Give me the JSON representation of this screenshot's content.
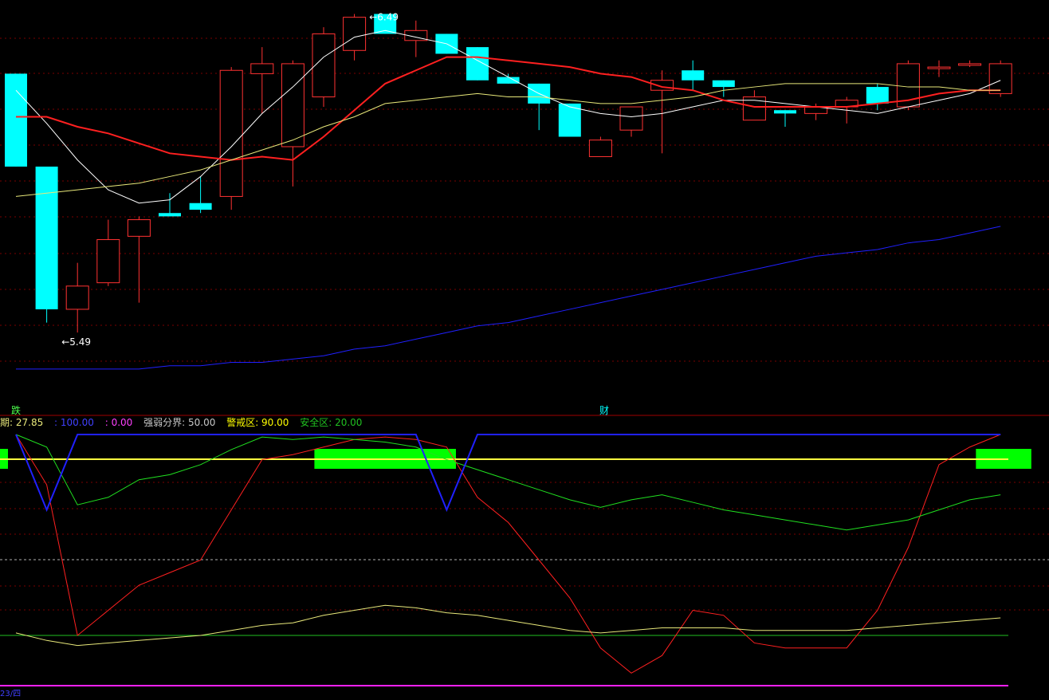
{
  "legend": {
    "period": "期: 27.85",
    "v1": ": 100.00",
    "v2": ": 0.00",
    "boundary": "强弱分界: 50.00",
    "warning": "警戒区: 90.00",
    "safe": "安全区: 20.00"
  },
  "tags": {
    "t1": "跌",
    "t2": "财"
  },
  "bottom_text": "23/四",
  "colors": {
    "up": "#ff3232",
    "down": "#00ffff",
    "ma_white": "#ffffff",
    "ma_red": "#ff2020",
    "ma_yellow": "#e8e87a",
    "ma_blue": "#2020ff",
    "grid": "#7a0000"
  },
  "chart_data": [
    {
      "type": "candlestick",
      "annotations": [
        {
          "text": "6.49",
          "candle": 12
        },
        {
          "text": "5.49",
          "candle": 2
        }
      ],
      "candles": [
        {
          "o": 6.31,
          "c": 6.03,
          "h": 6.31,
          "l": 6.03
        },
        {
          "o": 6.03,
          "c": 5.6,
          "h": 6.03,
          "l": 5.56
        },
        {
          "o": 5.6,
          "c": 5.67,
          "h": 5.74,
          "l": 5.53
        },
        {
          "o": 5.68,
          "c": 5.81,
          "h": 5.87,
          "l": 5.67
        },
        {
          "o": 5.82,
          "c": 5.87,
          "h": 5.88,
          "l": 5.62
        },
        {
          "o": 5.89,
          "c": 5.88,
          "h": 5.95,
          "l": 5.88
        },
        {
          "o": 5.92,
          "c": 5.9,
          "h": 6.0,
          "l": 5.89
        },
        {
          "o": 5.94,
          "c": 6.32,
          "h": 6.33,
          "l": 5.9
        },
        {
          "o": 6.31,
          "c": 6.34,
          "h": 6.39,
          "l": 6.19
        },
        {
          "o": 6.09,
          "c": 6.34,
          "h": 6.35,
          "l": 5.97
        },
        {
          "o": 6.24,
          "c": 6.43,
          "h": 6.45,
          "l": 6.21
        },
        {
          "o": 6.38,
          "c": 6.48,
          "h": 6.49,
          "l": 6.35
        },
        {
          "o": 6.49,
          "c": 6.43,
          "h": 6.49,
          "l": 6.43
        },
        {
          "o": 6.41,
          "c": 6.44,
          "h": 6.47,
          "l": 6.36
        },
        {
          "o": 6.43,
          "c": 6.37,
          "h": 6.43,
          "l": 6.37
        },
        {
          "o": 6.39,
          "c": 6.29,
          "h": 6.39,
          "l": 6.29
        },
        {
          "o": 6.3,
          "c": 6.28,
          "h": 6.31,
          "l": 6.28
        },
        {
          "o": 6.28,
          "c": 6.22,
          "h": 6.28,
          "l": 6.14
        },
        {
          "o": 6.22,
          "c": 6.12,
          "h": 6.22,
          "l": 6.12
        },
        {
          "o": 6.06,
          "c": 6.11,
          "h": 6.12,
          "l": 6.06
        },
        {
          "o": 6.14,
          "c": 6.21,
          "h": 6.21,
          "l": 6.12
        },
        {
          "o": 6.26,
          "c": 6.29,
          "h": 6.32,
          "l": 6.07
        },
        {
          "o": 6.32,
          "c": 6.29,
          "h": 6.35,
          "l": 6.26
        },
        {
          "o": 6.29,
          "c": 6.27,
          "h": 6.29,
          "l": 6.24
        },
        {
          "o": 6.17,
          "c": 6.24,
          "h": 6.26,
          "l": 6.17
        },
        {
          "o": 6.2,
          "c": 6.19,
          "h": 6.2,
          "l": 6.15
        },
        {
          "o": 6.19,
          "c": 6.21,
          "h": 6.22,
          "l": 6.17
        },
        {
          "o": 6.21,
          "c": 6.23,
          "h": 6.24,
          "l": 6.16
        },
        {
          "o": 6.27,
          "c": 6.22,
          "h": 6.28,
          "l": 6.2
        },
        {
          "o": 6.21,
          "c": 6.34,
          "h": 6.35,
          "l": 6.2
        },
        {
          "o": 6.33,
          "c": 6.33,
          "h": 6.35,
          "l": 6.3
        },
        {
          "o": 6.34,
          "c": 6.34,
          "h": 6.35,
          "l": 6.33
        },
        {
          "o": 6.25,
          "c": 6.34,
          "h": 6.35,
          "l": 6.24
        }
      ],
      "ma": [
        {
          "name": "white",
          "values": [
            6.26,
            6.16,
            6.05,
            5.96,
            5.92,
            5.93,
            6.0,
            6.09,
            6.19,
            6.27,
            6.36,
            6.42,
            6.44,
            6.42,
            6.4,
            6.35,
            6.3,
            6.25,
            6.21,
            6.19,
            6.18,
            6.19,
            6.21,
            6.23,
            6.23,
            6.22,
            6.21,
            6.2,
            6.19,
            6.21,
            6.23,
            6.25,
            6.29
          ]
        },
        {
          "name": "red",
          "values": [
            6.18,
            6.18,
            6.15,
            6.13,
            6.1,
            6.07,
            6.06,
            6.05,
            6.06,
            6.05,
            6.12,
            6.2,
            6.28,
            6.32,
            6.36,
            6.36,
            6.35,
            6.34,
            6.33,
            6.31,
            6.3,
            6.27,
            6.26,
            6.23,
            6.21,
            6.21,
            6.21,
            6.21,
            6.22,
            6.23,
            6.25,
            6.26,
            6.26
          ]
        },
        {
          "name": "yellow",
          "values": [
            5.94,
            5.95,
            5.96,
            5.97,
            5.98,
            6.0,
            6.02,
            6.05,
            6.08,
            6.11,
            6.15,
            6.18,
            6.22,
            6.23,
            6.24,
            6.25,
            6.24,
            6.24,
            6.23,
            6.22,
            6.22,
            6.23,
            6.24,
            6.26,
            6.27,
            6.28,
            6.28,
            6.28,
            6.28,
            6.27,
            6.27,
            6.26,
            6.26
          ]
        },
        {
          "name": "blue",
          "values": [
            5.42,
            5.42,
            5.42,
            5.42,
            5.42,
            5.43,
            5.43,
            5.44,
            5.44,
            5.45,
            5.46,
            5.48,
            5.49,
            5.51,
            5.53,
            5.55,
            5.56,
            5.58,
            5.6,
            5.62,
            5.64,
            5.66,
            5.68,
            5.7,
            5.72,
            5.74,
            5.76,
            5.77,
            5.78,
            5.8,
            5.81,
            5.83,
            5.85
          ]
        }
      ],
      "ylim": [
        5.35,
        6.52
      ]
    },
    {
      "type": "line",
      "ylim": [
        0,
        100
      ],
      "levels": [
        {
          "name": "强弱分界",
          "value": 50
        },
        {
          "name": "警戒区",
          "value": 90
        },
        {
          "name": "安全区",
          "value": 20
        }
      ],
      "series": [
        {
          "color": "red",
          "values": [
            100,
            80,
            20,
            30,
            40,
            45,
            50,
            70,
            90,
            92,
            95,
            98,
            99,
            98,
            95,
            75,
            65,
            50,
            35,
            15,
            5,
            12,
            30,
            28,
            17,
            15,
            15,
            15,
            30,
            55,
            88,
            95,
            100
          ]
        },
        {
          "color": "green",
          "values": [
            100,
            95,
            72,
            75,
            82,
            84,
            88,
            94,
            99,
            98,
            99,
            98,
            97,
            95,
            90,
            86,
            82,
            78,
            74,
            71,
            74,
            76,
            73,
            70,
            68,
            66,
            64,
            62,
            64,
            66,
            70,
            74,
            76
          ]
        },
        {
          "color": "blue",
          "values": [
            100,
            70,
            100,
            100,
            100,
            100,
            100,
            100,
            100,
            100,
            100,
            100,
            100,
            100,
            70,
            100,
            100,
            100,
            100,
            100,
            100,
            100,
            100,
            100,
            100,
            100,
            100,
            100,
            100,
            100,
            100,
            100,
            100
          ]
        },
        {
          "color": "yellow",
          "values": [
            21,
            18,
            16,
            17,
            18,
            19,
            20,
            22,
            24,
            25,
            28,
            30,
            32,
            31,
            29,
            28,
            26,
            24,
            22,
            21,
            22,
            23,
            23,
            23,
            22,
            22,
            22,
            22,
            23,
            24,
            25,
            26,
            27
          ]
        }
      ],
      "bands": [
        {
          "from": 0,
          "to": 0,
          "color": "green"
        },
        {
          "from": 9.7,
          "to": 14.3,
          "color": "green"
        },
        {
          "from": 31.2,
          "to": 33,
          "color": "green"
        }
      ]
    }
  ]
}
